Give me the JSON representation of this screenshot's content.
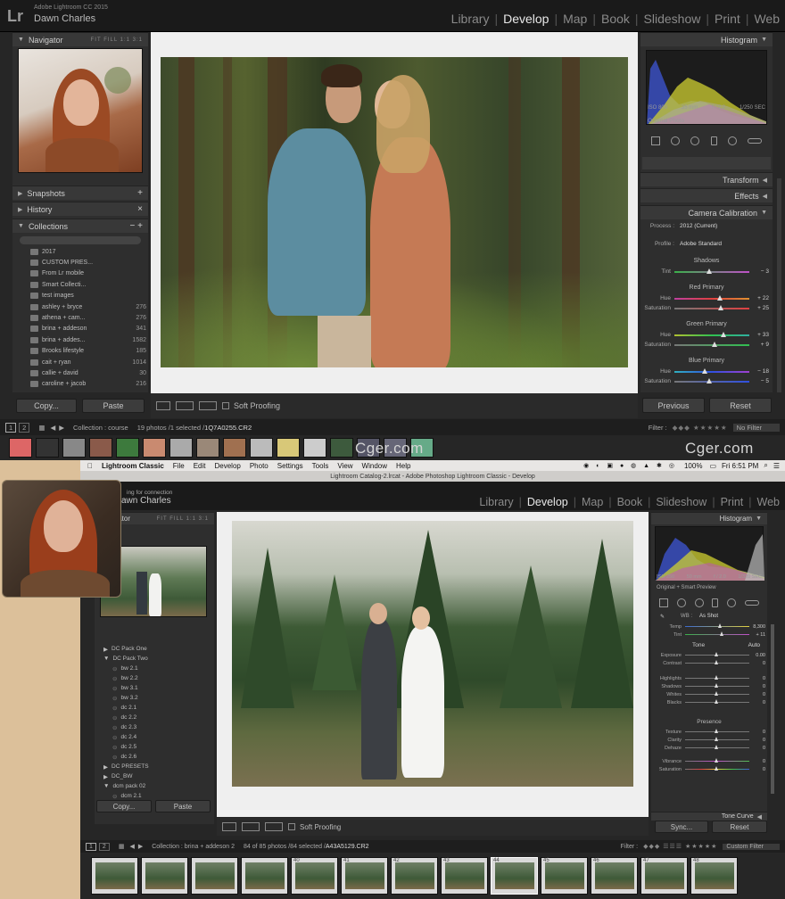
{
  "top": {
    "app_version": "Adobe Lightroom CC 2015",
    "user_name": "Dawn Charles",
    "logo": "Lr",
    "modules": [
      "Library",
      "Develop",
      "Map",
      "Book",
      "Slideshow",
      "Print",
      "Web"
    ],
    "active_module": "Develop",
    "left_panel": {
      "navigator_label": "Navigator",
      "nav_options": "FIT  FILL  1:1  3:1",
      "snapshots_label": "Snapshots",
      "history_label": "History",
      "collections_label": "Collections",
      "collections": [
        {
          "name": "2017",
          "count": ""
        },
        {
          "name": "CUSTOM PRES...",
          "count": ""
        },
        {
          "name": "From Lr mobile",
          "count": ""
        },
        {
          "name": "Smart Collecti...",
          "count": ""
        },
        {
          "name": "test images",
          "count": ""
        },
        {
          "name": "ashley + bryce",
          "count": "276"
        },
        {
          "name": "athena + cam...",
          "count": "276"
        },
        {
          "name": "brina + addeson",
          "count": "341"
        },
        {
          "name": "brina + addes...",
          "count": "1582"
        },
        {
          "name": "Brooks lifestyle",
          "count": "185"
        },
        {
          "name": "cait + ryan",
          "count": "1014"
        },
        {
          "name": "callie + david",
          "count": "30"
        },
        {
          "name": "caroline + jacob",
          "count": "216"
        }
      ],
      "copy_label": "Copy...",
      "paste_label": "Paste"
    },
    "toolbar": {
      "soft_proofing": "Soft Proofing"
    },
    "right_panel": {
      "histogram_label": "Histogram",
      "iso": "ISO 800",
      "focal": "35 mm",
      "aperture": "f / 2.2",
      "shutter": "1/250 SEC",
      "original_photo": "Original Photo",
      "transform_label": "Transform",
      "effects_label": "Effects",
      "calibration_label": "Camera Calibration",
      "process_label": "Process :",
      "process_value": "2012 (Current)",
      "profile_label": "Profile :",
      "profile_value": "Adobe Standard",
      "shadows_label": "Shadows",
      "red_primary_label": "Red Primary",
      "green_primary_label": "Green Primary",
      "blue_primary_label": "Blue Primary",
      "sliders": [
        {
          "label": "Tint",
          "value": "− 3",
          "pos": 0.47
        },
        {
          "label": "Hue",
          "value": "+ 22",
          "pos": 0.61
        },
        {
          "label": "Saturation",
          "value": "+ 25",
          "pos": 0.62
        },
        {
          "label": "Hue",
          "value": "+ 33",
          "pos": 0.66
        },
        {
          "label": "Saturation",
          "value": "+ 9",
          "pos": 0.54
        },
        {
          "label": "Hue",
          "value": "− 18",
          "pos": 0.41
        },
        {
          "label": "Saturation",
          "value": "− 5",
          "pos": 0.47
        }
      ],
      "previous_label": "Previous",
      "reset_label": "Reset"
    },
    "filmbar": {
      "page1": "1",
      "page2": "2",
      "collection": "Collection : course",
      "photos": "19 photos /1 selected /",
      "filename": "1Q7A0255.CR2",
      "filter_label": "Filter :",
      "filter_value": "No Filter"
    },
    "watermark": "Cger.com"
  },
  "bottom": {
    "menubar": {
      "apple": "",
      "app": "Lightroom Classic",
      "items": [
        "File",
        "Edit",
        "Develop",
        "Photo",
        "Settings",
        "Tools",
        "View",
        "Window",
        "Help"
      ],
      "battery": "100%",
      "clock": "Fri 6:51 PM"
    },
    "window_title": "Lightroom Catalog-2.lrcat - Adobe Photoshop Lightroom Classic - Develop",
    "tagline": "ing for connection",
    "user_name": "awn Charles",
    "modules": [
      "Library",
      "Develop",
      "Map",
      "Book",
      "Slideshow",
      "Print",
      "Web"
    ],
    "navigator_label": "vigator",
    "nav_options": "FIT  FILL  1:1  3:1",
    "presets": [
      "DC Pack One",
      "DC Pack Two",
      "bw 2.1",
      "bw 2.2",
      "bw 3.1",
      "bw 3.2",
      "dc 2.1",
      "dc 2.2",
      "dc 2.3",
      "dc 2.4",
      "dc 2.5",
      "dc 2.6",
      "DC PRESETS",
      "DC_BW",
      "dcm pack 02",
      "dcm 2.1"
    ],
    "copy_label": "Copy...",
    "paste_label": "Paste",
    "soft_proofing": "Soft Proofing",
    "histogram_label": "Histogram",
    "iso": "ISO 250",
    "focal": "50 mm",
    "aperture": "f / 2.0",
    "shutter": "1/320 SEC",
    "smart_preview": "Original + Smart Preview",
    "wb_label": "WB :",
    "wb_value": "As Shot",
    "tone_label": "Tone",
    "auto_label": "Auto",
    "presence_label": "Presence",
    "tone_curve_label": "Tone Curve",
    "basic_sliders": [
      {
        "label": "Temp",
        "value": "8,300",
        "pos": 0.55
      },
      {
        "label": "Tint",
        "value": "+ 11",
        "pos": 0.58
      },
      {
        "label": "Exposure",
        "value": "0.00",
        "pos": 0.5
      },
      {
        "label": "Contrast",
        "value": "0",
        "pos": 0.5
      },
      {
        "label": "Highlights",
        "value": "0",
        "pos": 0.5
      },
      {
        "label": "Shadows",
        "value": "0",
        "pos": 0.5
      },
      {
        "label": "Whites",
        "value": "0",
        "pos": 0.5
      },
      {
        "label": "Blacks",
        "value": "0",
        "pos": 0.5
      },
      {
        "label": "Texture",
        "value": "0",
        "pos": 0.5
      },
      {
        "label": "Clarity",
        "value": "0",
        "pos": 0.5
      },
      {
        "label": "Dehaze",
        "value": "0",
        "pos": 0.5
      },
      {
        "label": "Vibrance",
        "value": "0",
        "pos": 0.5
      },
      {
        "label": "Saturation",
        "value": "0",
        "pos": 0.5
      }
    ],
    "sync_label": "Sync...",
    "reset_label": "Reset",
    "filmbar": {
      "page1": "1",
      "page2": "2",
      "collection": "Collection : brina + addeson 2",
      "photos": "84 of 85 photos /84 selected /",
      "filename": "A43A5129.CR2",
      "filter_label": "Filter :",
      "filter_value": "Custom Filter"
    },
    "filmstrip_numbers": [
      "",
      "",
      "",
      "",
      "40",
      "41",
      "42",
      "43",
      "44",
      "45",
      "46",
      "47",
      "48",
      "49"
    ]
  }
}
